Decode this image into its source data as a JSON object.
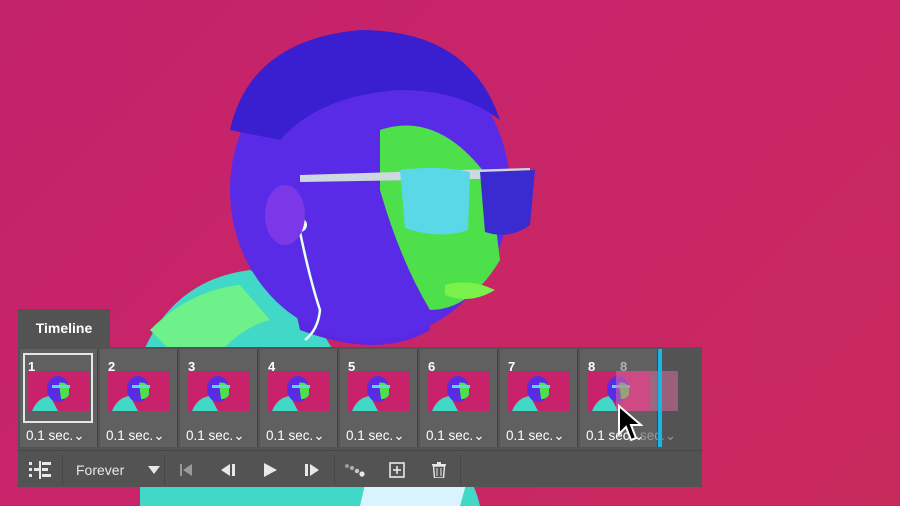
{
  "timeline": {
    "title": "Timeline",
    "frames": [
      {
        "number": "1",
        "delay": "0.1 sec."
      },
      {
        "number": "2",
        "delay": "0.1 sec."
      },
      {
        "number": "3",
        "delay": "0.1 sec."
      },
      {
        "number": "4",
        "delay": "0.1 sec."
      },
      {
        "number": "5",
        "delay": "0.1 sec."
      },
      {
        "number": "6",
        "delay": "0.1 sec."
      },
      {
        "number": "7",
        "delay": "0.1 sec."
      },
      {
        "number": "8",
        "delay": "0.1 sec."
      }
    ],
    "dragged_frame": {
      "number": "8",
      "delay": "0.1 sec."
    },
    "controls": {
      "loop_option": "Forever",
      "convert_icon": "convert-to-video-timeline-icon",
      "first_icon": "first-frame-icon",
      "prev_icon": "previous-frame-icon",
      "play_icon": "play-icon",
      "next_icon": "next-frame-icon",
      "tween_icon": "tween-icon",
      "duplicate_icon": "duplicate-frame-icon",
      "delete_icon": "delete-frame-icon"
    }
  },
  "colors": {
    "background": "#c2226a",
    "panel": "#535353",
    "accent": "#18b6e6"
  }
}
